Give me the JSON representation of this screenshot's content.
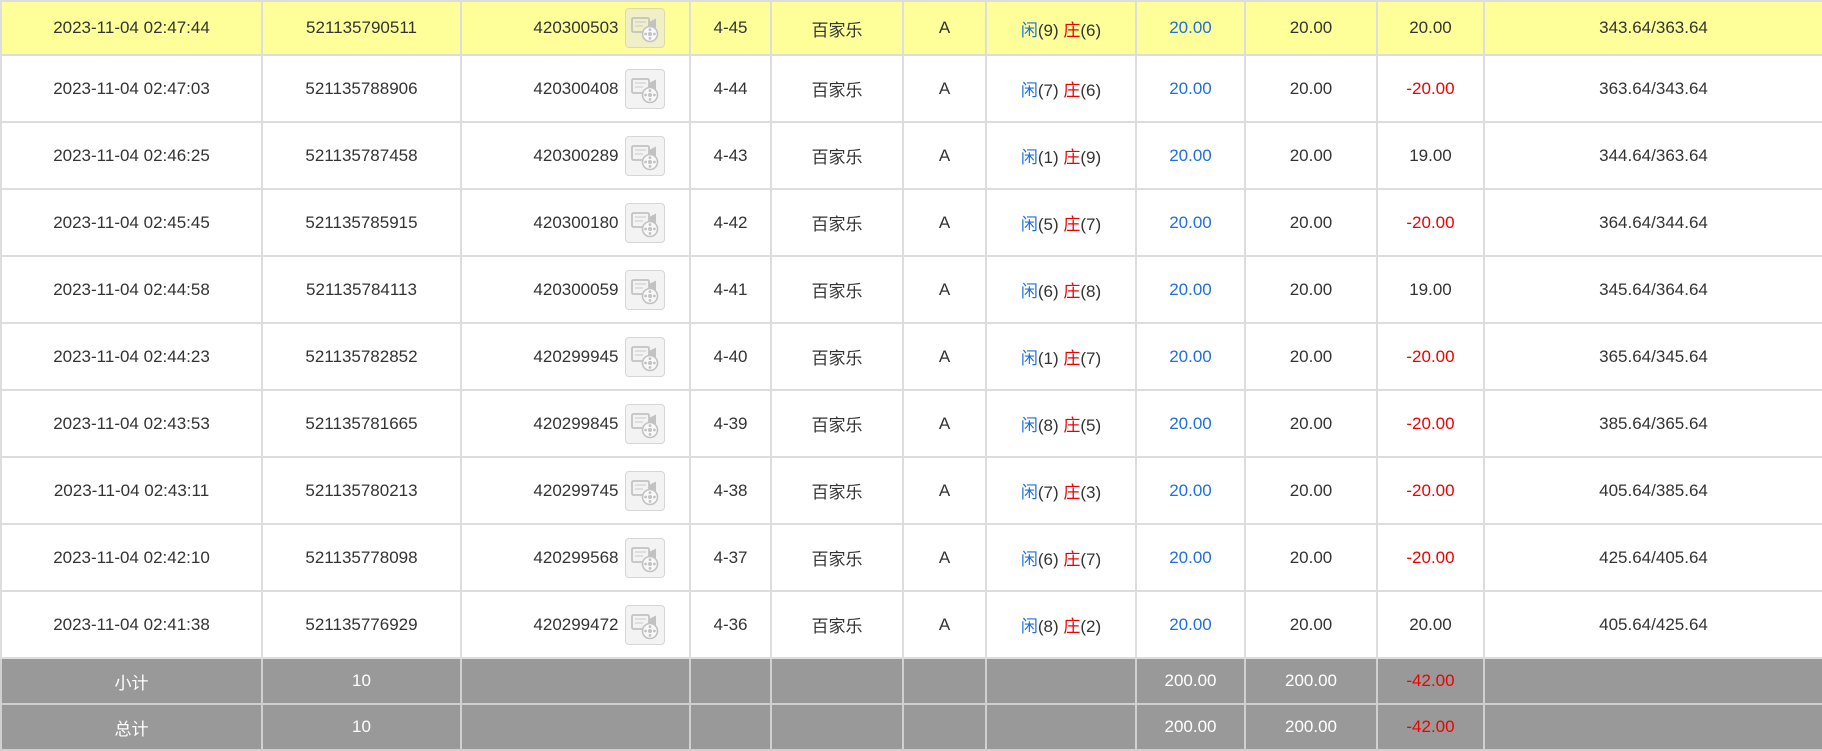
{
  "rows": [
    {
      "time": "2023-11-04 02:47:44",
      "bet_id": "521135790511",
      "game_no": "420300503",
      "shoe": "4-45",
      "game": "百家乐",
      "table": "A",
      "player_label": "闲",
      "player_val": "(9)",
      "banker_label": "庄",
      "banker_val": "(6)",
      "bet": "20.00",
      "valid": "20.00",
      "win": "20.00",
      "win_color": "black",
      "balance": "343.64/363.64",
      "icon": "video-replay-icon"
    },
    {
      "time": "2023-11-04 02:47:03",
      "bet_id": "521135788906",
      "game_no": "420300408",
      "shoe": "4-44",
      "game": "百家乐",
      "table": "A",
      "player_label": "闲",
      "player_val": "(7)",
      "banker_label": "庄",
      "banker_val": "(6)",
      "bet": "20.00",
      "valid": "20.00",
      "win": "-20.00",
      "win_color": "red",
      "balance": "363.64/343.64",
      "icon": "video-replay-icon"
    },
    {
      "time": "2023-11-04 02:46:25",
      "bet_id": "521135787458",
      "game_no": "420300289",
      "shoe": "4-43",
      "game": "百家乐",
      "table": "A",
      "player_label": "闲",
      "player_val": "(1)",
      "banker_label": "庄",
      "banker_val": "(9)",
      "bet": "20.00",
      "valid": "20.00",
      "win": "19.00",
      "win_color": "black",
      "balance": "344.64/363.64",
      "icon": "video-replay-icon"
    },
    {
      "time": "2023-11-04 02:45:45",
      "bet_id": "521135785915",
      "game_no": "420300180",
      "shoe": "4-42",
      "game": "百家乐",
      "table": "A",
      "player_label": "闲",
      "player_val": "(5)",
      "banker_label": "庄",
      "banker_val": "(7)",
      "bet": "20.00",
      "valid": "20.00",
      "win": "-20.00",
      "win_color": "red",
      "balance": "364.64/344.64",
      "icon": "video-replay-icon"
    },
    {
      "time": "2023-11-04 02:44:58",
      "bet_id": "521135784113",
      "game_no": "420300059",
      "shoe": "4-41",
      "game": "百家乐",
      "table": "A",
      "player_label": "闲",
      "player_val": "(6)",
      "banker_label": "庄",
      "banker_val": "(8)",
      "bet": "20.00",
      "valid": "20.00",
      "win": "19.00",
      "win_color": "black",
      "balance": "345.64/364.64",
      "icon": "video-replay-icon"
    },
    {
      "time": "2023-11-04 02:44:23",
      "bet_id": "521135782852",
      "game_no": "420299945",
      "shoe": "4-40",
      "game": "百家乐",
      "table": "A",
      "player_label": "闲",
      "player_val": "(1)",
      "banker_label": "庄",
      "banker_val": "(7)",
      "bet": "20.00",
      "valid": "20.00",
      "win": "-20.00",
      "win_color": "red",
      "balance": "365.64/345.64",
      "icon": "video-replay-icon"
    },
    {
      "time": "2023-11-04 02:43:53",
      "bet_id": "521135781665",
      "game_no": "420299845",
      "shoe": "4-39",
      "game": "百家乐",
      "table": "A",
      "player_label": "闲",
      "player_val": "(8)",
      "banker_label": "庄",
      "banker_val": "(5)",
      "bet": "20.00",
      "valid": "20.00",
      "win": "-20.00",
      "win_color": "red",
      "balance": "385.64/365.64",
      "icon": "video-replay-icon"
    },
    {
      "time": "2023-11-04 02:43:11",
      "bet_id": "521135780213",
      "game_no": "420299745",
      "shoe": "4-38",
      "game": "百家乐",
      "table": "A",
      "player_label": "闲",
      "player_val": "(7)",
      "banker_label": "庄",
      "banker_val": "(3)",
      "bet": "20.00",
      "valid": "20.00",
      "win": "-20.00",
      "win_color": "red",
      "balance": "405.64/385.64",
      "icon": "video-replay-icon"
    },
    {
      "time": "2023-11-04 02:42:10",
      "bet_id": "521135778098",
      "game_no": "420299568",
      "shoe": "4-37",
      "game": "百家乐",
      "table": "A",
      "player_label": "闲",
      "player_val": "(6)",
      "banker_label": "庄",
      "banker_val": "(7)",
      "bet": "20.00",
      "valid": "20.00",
      "win": "-20.00",
      "win_color": "red",
      "balance": "425.64/405.64",
      "icon": "video-replay-icon"
    },
    {
      "time": "2023-11-04 02:41:38",
      "bet_id": "521135776929",
      "game_no": "420299472",
      "shoe": "4-36",
      "game": "百家乐",
      "table": "A",
      "player_label": "闲",
      "player_val": "(8)",
      "banker_label": "庄",
      "banker_val": "(2)",
      "bet": "20.00",
      "valid": "20.00",
      "win": "20.00",
      "win_color": "black",
      "balance": "405.64/425.64",
      "icon": "video-replay-icon"
    }
  ],
  "summary": [
    {
      "label": "小计",
      "count": "10",
      "bet": "200.00",
      "valid": "200.00",
      "win": "-42.00"
    },
    {
      "label": "总计",
      "count": "10",
      "bet": "200.00",
      "valid": "200.00",
      "win": "-42.00"
    }
  ],
  "colors": {
    "highlight_row": "#ffff99",
    "summary_bg": "#999999",
    "player_blue": "#1f6fe0",
    "banker_red": "#ee0000",
    "negative_red": "#ee0000",
    "border": "#dddddd"
  }
}
